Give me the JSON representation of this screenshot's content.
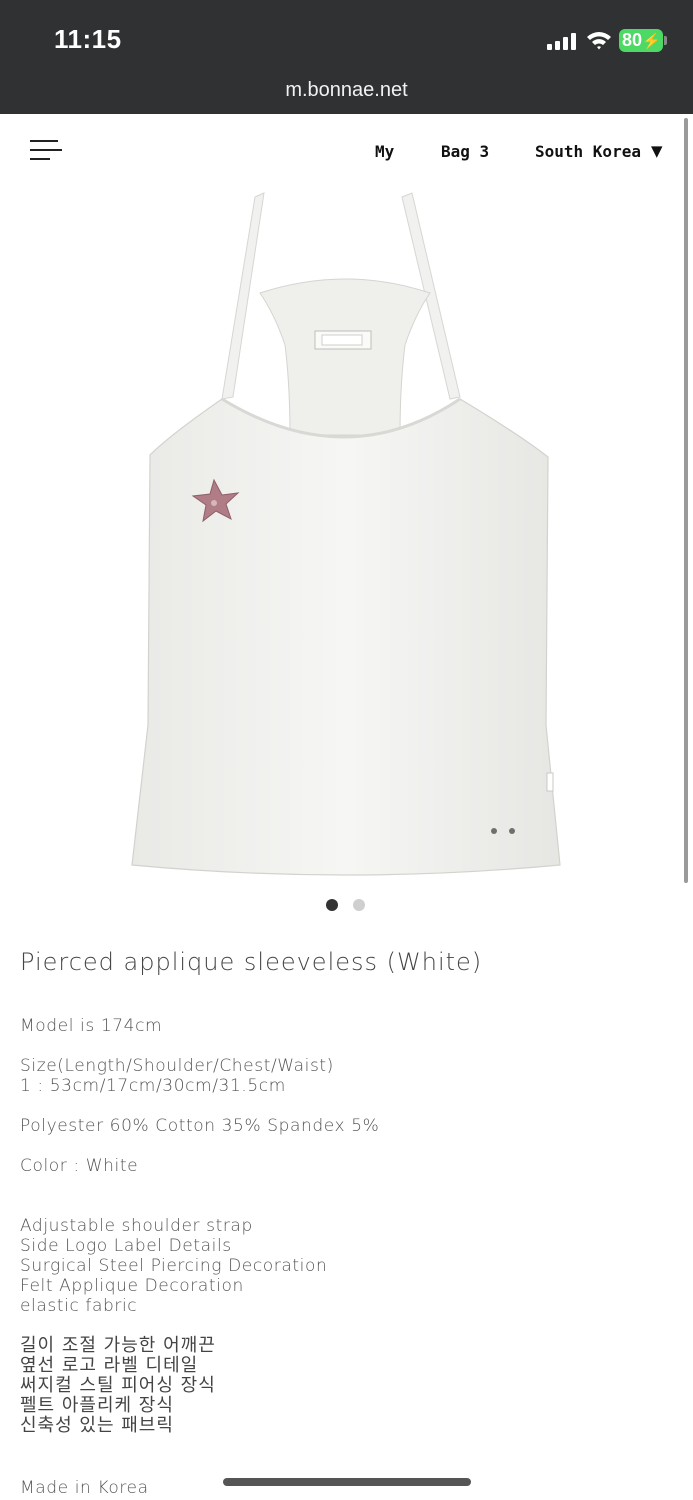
{
  "status_bar": {
    "time": "11:15",
    "battery": "80"
  },
  "browser": {
    "url": "m.bonnae.net"
  },
  "header": {
    "my_label": "My",
    "bag_label": "Bag 3",
    "region_label": "South Korea"
  },
  "icons": {
    "menu": "hamburger-menu-icon",
    "caret": "caret-down-icon",
    "signal": "cellular-signal-icon",
    "wifi": "wifi-icon",
    "battery": "battery-charging-icon"
  },
  "colors": {
    "status_bg": "#2f3133",
    "battery": "#4cd964",
    "dot_active": "#333333",
    "dot_inactive": "#cfcfcf",
    "applique": "#b07c86"
  },
  "carousel": {
    "count": 2,
    "active_index": 0
  },
  "product": {
    "title": "Pierced applique sleeveless (White)",
    "model": "Model is 174cm",
    "size_heading": "Size(Length/Shoulder/Chest/Waist)",
    "size_values": "1 : 53cm/17cm/30cm/31.5cm",
    "material": "Polyester 60% Cotton 35% Spandex 5%",
    "color": "Color : White",
    "features_en": [
      "Adjustable shoulder strap",
      "Side Logo Label Details",
      "Surgical Steel Piercing Decoration",
      "Felt Applique Decoration",
      "elastic fabric"
    ],
    "features_ko": [
      "길이 조절 가능한 어깨끈",
      "옆선 로고 라벨 디테일",
      "써지컬 스틸 피어싱 장식",
      "펠트 아플리케 장식",
      "신축성 있는 패브릭"
    ],
    "origin": "Made in Korea"
  }
}
